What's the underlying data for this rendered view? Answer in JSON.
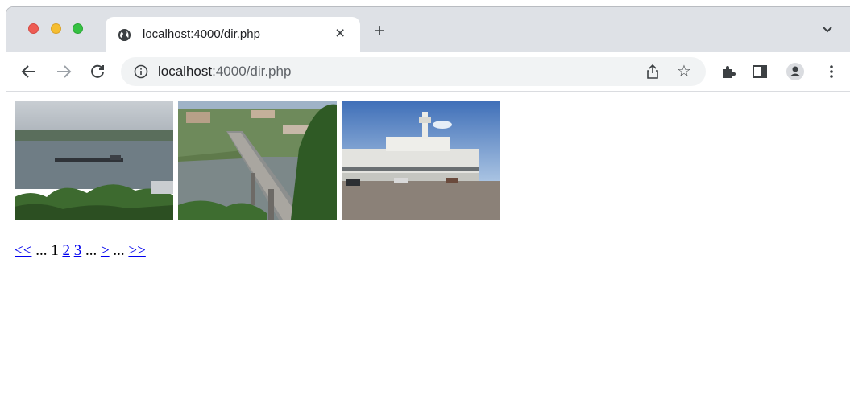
{
  "browser": {
    "tab": {
      "title": "localhost:4000/dir.php"
    },
    "address": {
      "host": "localhost",
      "path": ":4000/dir.php"
    }
  },
  "gallery": {
    "images": [
      {
        "name": "river-barge-photo"
      },
      {
        "name": "bridge-photo"
      },
      {
        "name": "river-station-photo"
      }
    ]
  },
  "pagination": {
    "first": "<<",
    "ellipsis_1": "...",
    "current": "1",
    "page_2": "2",
    "page_3": "3",
    "ellipsis_2": "...",
    "next": ">",
    "ellipsis_3": "...",
    "last": ">>"
  },
  "colors": {
    "link": "#0000ee",
    "tabstrip": "#dee1e6",
    "omnibox": "#f1f3f4"
  }
}
